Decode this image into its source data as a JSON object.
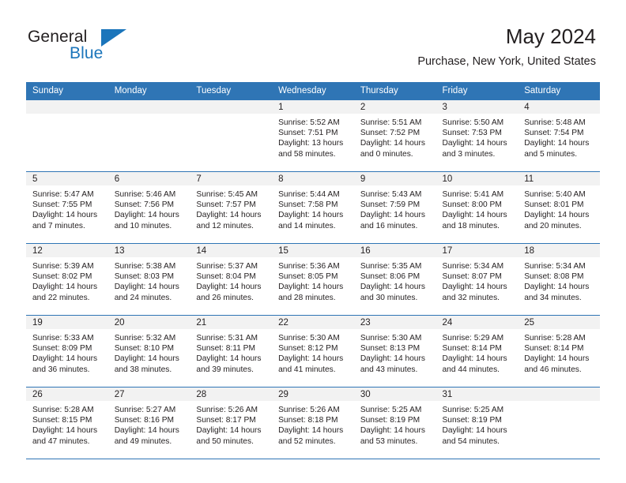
{
  "brand": {
    "name_part1": "General",
    "name_part2": "Blue",
    "accent_color": "#1b75bb"
  },
  "header": {
    "title": "May 2024",
    "subtitle": "Purchase, New York, United States"
  },
  "calendar": {
    "header_bg": "#2f75b5",
    "daynum_bg": "#f2f2f2",
    "weekdays": [
      "Sunday",
      "Monday",
      "Tuesday",
      "Wednesday",
      "Thursday",
      "Friday",
      "Saturday"
    ],
    "weeks": [
      [
        {
          "day": "",
          "sunrise": "",
          "sunset": "",
          "daylight": "",
          "daylight2": ""
        },
        {
          "day": "",
          "sunrise": "",
          "sunset": "",
          "daylight": "",
          "daylight2": ""
        },
        {
          "day": "",
          "sunrise": "",
          "sunset": "",
          "daylight": "",
          "daylight2": ""
        },
        {
          "day": "1",
          "sunrise": "Sunrise: 5:52 AM",
          "sunset": "Sunset: 7:51 PM",
          "daylight": "Daylight: 13 hours",
          "daylight2": "and 58 minutes."
        },
        {
          "day": "2",
          "sunrise": "Sunrise: 5:51 AM",
          "sunset": "Sunset: 7:52 PM",
          "daylight": "Daylight: 14 hours",
          "daylight2": "and 0 minutes."
        },
        {
          "day": "3",
          "sunrise": "Sunrise: 5:50 AM",
          "sunset": "Sunset: 7:53 PM",
          "daylight": "Daylight: 14 hours",
          "daylight2": "and 3 minutes."
        },
        {
          "day": "4",
          "sunrise": "Sunrise: 5:48 AM",
          "sunset": "Sunset: 7:54 PM",
          "daylight": "Daylight: 14 hours",
          "daylight2": "and 5 minutes."
        }
      ],
      [
        {
          "day": "5",
          "sunrise": "Sunrise: 5:47 AM",
          "sunset": "Sunset: 7:55 PM",
          "daylight": "Daylight: 14 hours",
          "daylight2": "and 7 minutes."
        },
        {
          "day": "6",
          "sunrise": "Sunrise: 5:46 AM",
          "sunset": "Sunset: 7:56 PM",
          "daylight": "Daylight: 14 hours",
          "daylight2": "and 10 minutes."
        },
        {
          "day": "7",
          "sunrise": "Sunrise: 5:45 AM",
          "sunset": "Sunset: 7:57 PM",
          "daylight": "Daylight: 14 hours",
          "daylight2": "and 12 minutes."
        },
        {
          "day": "8",
          "sunrise": "Sunrise: 5:44 AM",
          "sunset": "Sunset: 7:58 PM",
          "daylight": "Daylight: 14 hours",
          "daylight2": "and 14 minutes."
        },
        {
          "day": "9",
          "sunrise": "Sunrise: 5:43 AM",
          "sunset": "Sunset: 7:59 PM",
          "daylight": "Daylight: 14 hours",
          "daylight2": "and 16 minutes."
        },
        {
          "day": "10",
          "sunrise": "Sunrise: 5:41 AM",
          "sunset": "Sunset: 8:00 PM",
          "daylight": "Daylight: 14 hours",
          "daylight2": "and 18 minutes."
        },
        {
          "day": "11",
          "sunrise": "Sunrise: 5:40 AM",
          "sunset": "Sunset: 8:01 PM",
          "daylight": "Daylight: 14 hours",
          "daylight2": "and 20 minutes."
        }
      ],
      [
        {
          "day": "12",
          "sunrise": "Sunrise: 5:39 AM",
          "sunset": "Sunset: 8:02 PM",
          "daylight": "Daylight: 14 hours",
          "daylight2": "and 22 minutes."
        },
        {
          "day": "13",
          "sunrise": "Sunrise: 5:38 AM",
          "sunset": "Sunset: 8:03 PM",
          "daylight": "Daylight: 14 hours",
          "daylight2": "and 24 minutes."
        },
        {
          "day": "14",
          "sunrise": "Sunrise: 5:37 AM",
          "sunset": "Sunset: 8:04 PM",
          "daylight": "Daylight: 14 hours",
          "daylight2": "and 26 minutes."
        },
        {
          "day": "15",
          "sunrise": "Sunrise: 5:36 AM",
          "sunset": "Sunset: 8:05 PM",
          "daylight": "Daylight: 14 hours",
          "daylight2": "and 28 minutes."
        },
        {
          "day": "16",
          "sunrise": "Sunrise: 5:35 AM",
          "sunset": "Sunset: 8:06 PM",
          "daylight": "Daylight: 14 hours",
          "daylight2": "and 30 minutes."
        },
        {
          "day": "17",
          "sunrise": "Sunrise: 5:34 AM",
          "sunset": "Sunset: 8:07 PM",
          "daylight": "Daylight: 14 hours",
          "daylight2": "and 32 minutes."
        },
        {
          "day": "18",
          "sunrise": "Sunrise: 5:34 AM",
          "sunset": "Sunset: 8:08 PM",
          "daylight": "Daylight: 14 hours",
          "daylight2": "and 34 minutes."
        }
      ],
      [
        {
          "day": "19",
          "sunrise": "Sunrise: 5:33 AM",
          "sunset": "Sunset: 8:09 PM",
          "daylight": "Daylight: 14 hours",
          "daylight2": "and 36 minutes."
        },
        {
          "day": "20",
          "sunrise": "Sunrise: 5:32 AM",
          "sunset": "Sunset: 8:10 PM",
          "daylight": "Daylight: 14 hours",
          "daylight2": "and 38 minutes."
        },
        {
          "day": "21",
          "sunrise": "Sunrise: 5:31 AM",
          "sunset": "Sunset: 8:11 PM",
          "daylight": "Daylight: 14 hours",
          "daylight2": "and 39 minutes."
        },
        {
          "day": "22",
          "sunrise": "Sunrise: 5:30 AM",
          "sunset": "Sunset: 8:12 PM",
          "daylight": "Daylight: 14 hours",
          "daylight2": "and 41 minutes."
        },
        {
          "day": "23",
          "sunrise": "Sunrise: 5:30 AM",
          "sunset": "Sunset: 8:13 PM",
          "daylight": "Daylight: 14 hours",
          "daylight2": "and 43 minutes."
        },
        {
          "day": "24",
          "sunrise": "Sunrise: 5:29 AM",
          "sunset": "Sunset: 8:14 PM",
          "daylight": "Daylight: 14 hours",
          "daylight2": "and 44 minutes."
        },
        {
          "day": "25",
          "sunrise": "Sunrise: 5:28 AM",
          "sunset": "Sunset: 8:14 PM",
          "daylight": "Daylight: 14 hours",
          "daylight2": "and 46 minutes."
        }
      ],
      [
        {
          "day": "26",
          "sunrise": "Sunrise: 5:28 AM",
          "sunset": "Sunset: 8:15 PM",
          "daylight": "Daylight: 14 hours",
          "daylight2": "and 47 minutes."
        },
        {
          "day": "27",
          "sunrise": "Sunrise: 5:27 AM",
          "sunset": "Sunset: 8:16 PM",
          "daylight": "Daylight: 14 hours",
          "daylight2": "and 49 minutes."
        },
        {
          "day": "28",
          "sunrise": "Sunrise: 5:26 AM",
          "sunset": "Sunset: 8:17 PM",
          "daylight": "Daylight: 14 hours",
          "daylight2": "and 50 minutes."
        },
        {
          "day": "29",
          "sunrise": "Sunrise: 5:26 AM",
          "sunset": "Sunset: 8:18 PM",
          "daylight": "Daylight: 14 hours",
          "daylight2": "and 52 minutes."
        },
        {
          "day": "30",
          "sunrise": "Sunrise: 5:25 AM",
          "sunset": "Sunset: 8:19 PM",
          "daylight": "Daylight: 14 hours",
          "daylight2": "and 53 minutes."
        },
        {
          "day": "31",
          "sunrise": "Sunrise: 5:25 AM",
          "sunset": "Sunset: 8:19 PM",
          "daylight": "Daylight: 14 hours",
          "daylight2": "and 54 minutes."
        },
        {
          "day": "",
          "sunrise": "",
          "sunset": "",
          "daylight": "",
          "daylight2": ""
        }
      ]
    ]
  }
}
